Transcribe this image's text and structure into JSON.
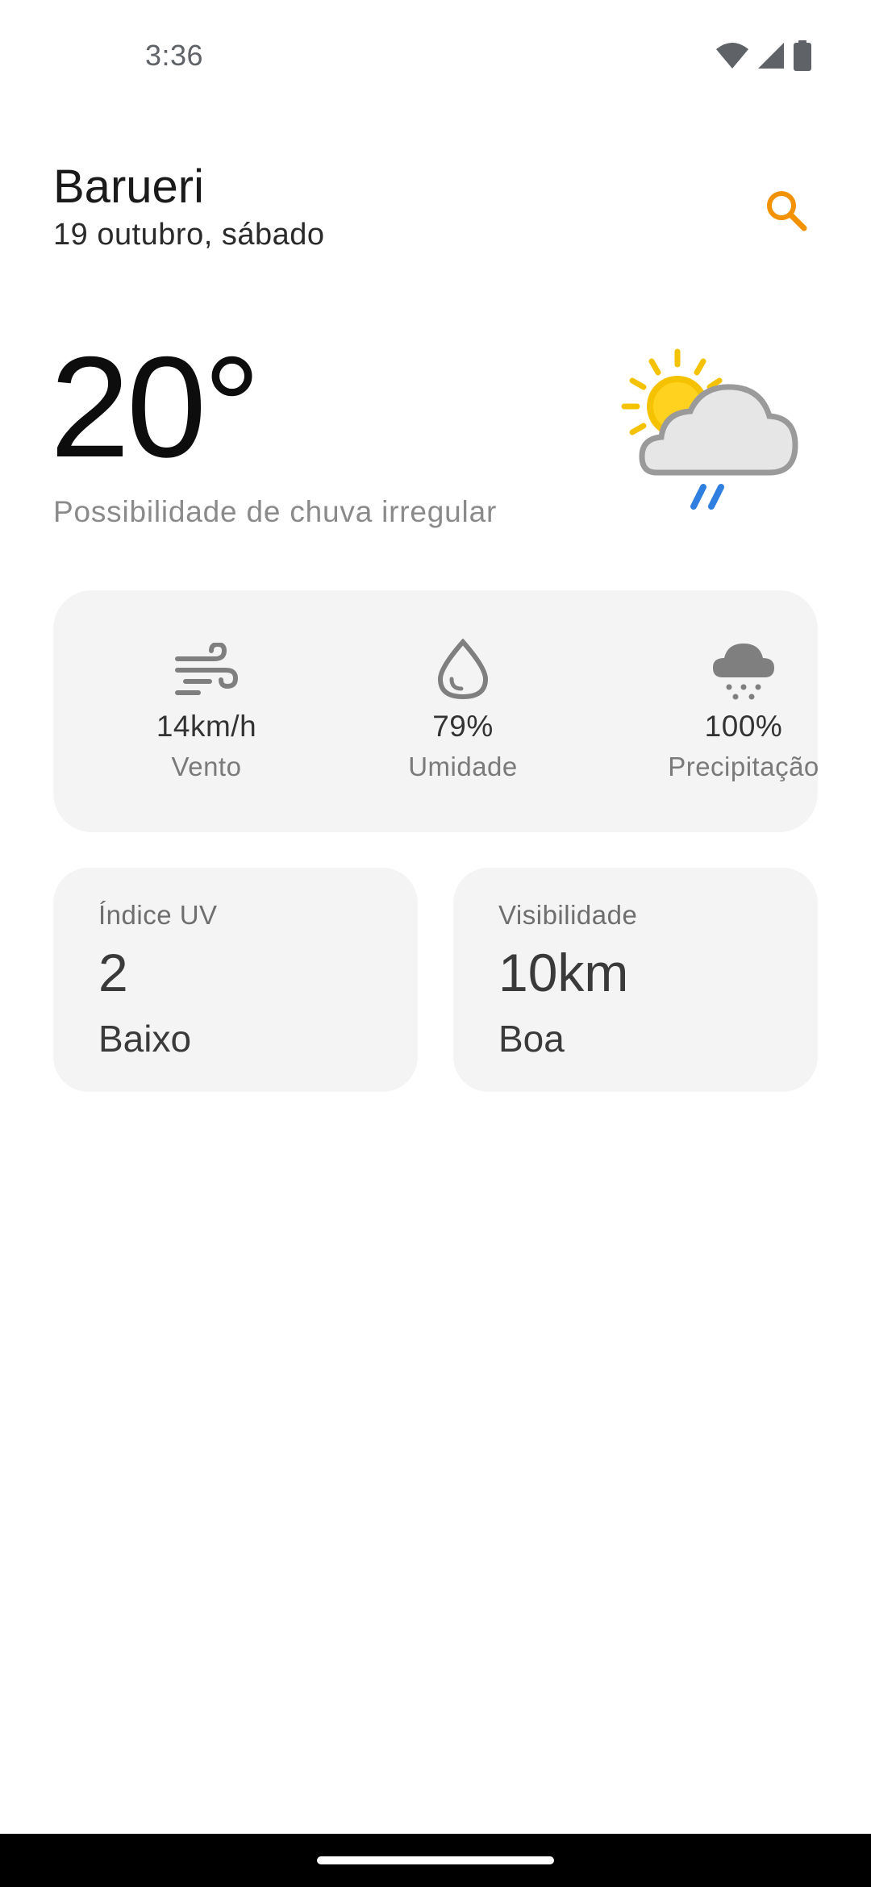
{
  "status_bar": {
    "time": "3:36",
    "icons": [
      "wifi-icon",
      "signal-icon",
      "battery-icon"
    ]
  },
  "header": {
    "city": "Barueri",
    "date": "19 outubro, sábado",
    "search_icon": "search-icon"
  },
  "current": {
    "temperature": "20°",
    "condition": "Possibilidade de chuva irregular",
    "icon": "sun-cloud-rain-icon"
  },
  "stats": {
    "wind": {
      "value": "14km/h",
      "label": "Vento",
      "icon": "wind-icon"
    },
    "humidity": {
      "value": "79%",
      "label": "Umidade",
      "icon": "droplet-icon"
    },
    "precipitation": {
      "value": "100%",
      "label": "Precipitação",
      "icon": "rain-cloud-icon"
    }
  },
  "uv": {
    "title": "Índice UV",
    "value": "2",
    "level": "Baixo"
  },
  "visibility": {
    "title": "Visibilidade",
    "value": "10km",
    "level": "Boa"
  },
  "colors": {
    "accent": "#f39200",
    "card_bg": "#f4f4f4",
    "text_muted": "#8a8a8a",
    "rain_blue": "#2f7fe0",
    "sun_yellow": "#f5c200"
  }
}
